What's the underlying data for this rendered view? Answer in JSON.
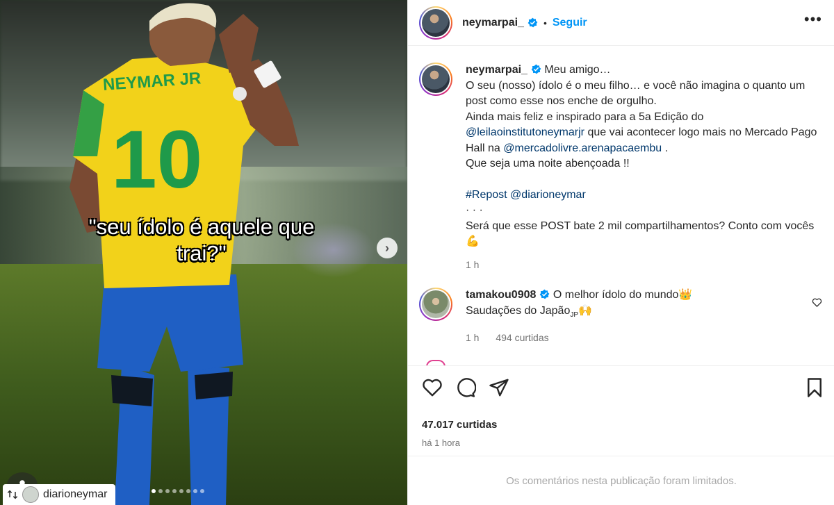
{
  "post": {
    "author": "neymarpai_",
    "separator": "•",
    "follow_label": "Seguir",
    "more_icon": "more-icon"
  },
  "media": {
    "overlay_text": "\"seu ídolo é aquele que trai?\"",
    "jersey_name": "NEYMAR JR",
    "jersey_number": "10",
    "tagged_user": "diarioneymar",
    "next_icon": "chevron-right-icon"
  },
  "caption": {
    "author": "neymarpai_",
    "opening": "Meu amigo…",
    "line1": "O seu (nosso) ídolo é o meu filho… e você não imagina o quanto um post como esse nos enche de orgulho.",
    "line2": "Ainda mais feliz e inspirado para a 5a Edição do",
    "mention1": "@leilaoinstitutoneymarjr",
    "line3": "que vai acontecer logo mais no Mercado Pago Hall na",
    "mention2": "@mercadolivre.arenapacaembu",
    "line3_end": ".",
    "line4": "Que seja uma noite abençoada !!",
    "hashtag": "#Repost",
    "mention3": "@diarioneymar",
    "dots": "· · ·",
    "line5": "Será que esse POST bate 2 mil compartilhamentos? Conto com vocês",
    "emoji": "💪",
    "time": "1 h"
  },
  "comment": {
    "author": "tamakou0908",
    "text": "O melhor ídolo do mundo",
    "emoji1": "👑",
    "line2": "Saudações do Japão",
    "country": "JP",
    "emoji2": "🙌",
    "time": "1 h",
    "likes": "494 curtidas"
  },
  "actions": {
    "likes": "47.017 curtidas",
    "time": "há 1 hora",
    "limited_notice": "Os comentários nesta publicação foram limitados."
  },
  "colors": {
    "accent": "#0095f6",
    "link": "#00376b",
    "muted": "#737373",
    "jersey_yellow": "#f2d21a",
    "jersey_green": "#1f9a4a",
    "shorts_blue": "#1f5fc4"
  }
}
